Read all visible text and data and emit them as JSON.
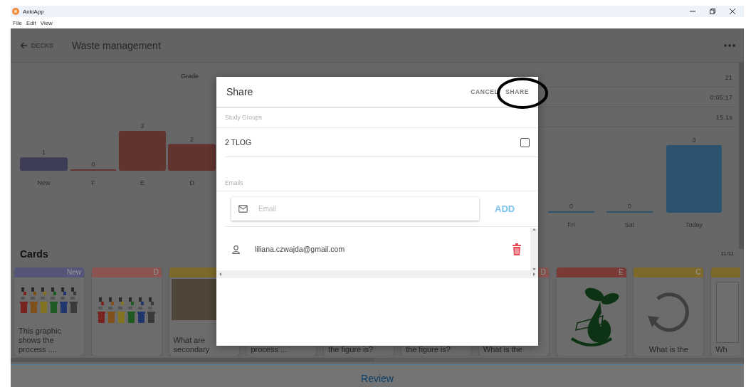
{
  "window": {
    "title": "AnkiApp"
  },
  "menu": [
    "File",
    "Edit",
    "View"
  ],
  "header": {
    "back_label": "DECKS",
    "title": "Waste management"
  },
  "grade": {
    "label": "Grade"
  },
  "grade_chart": {
    "chart_data": {
      "type": "bar",
      "categories": [
        "New",
        "F",
        "E",
        "D"
      ],
      "series": [
        {
          "color": "#3d3d55",
          "values": [
            1,
            null,
            null,
            null
          ]
        },
        {
          "color": "#62332f",
          "values": [
            null,
            0,
            3,
            2
          ]
        }
      ],
      "data_labels": true
    }
  },
  "stats": [
    {
      "value": "21"
    },
    {
      "value": "0:05:17"
    },
    {
      "value": "15.1s"
    }
  ],
  "review_chart": {
    "chart_data": {
      "type": "bar",
      "categories": [
        "Fri",
        "Sat",
        "Today"
      ],
      "series": [
        {
          "color": "#2b5370",
          "values": [
            0,
            0,
            3
          ]
        }
      ],
      "data_labels": true
    }
  },
  "cards": {
    "title": "Cards",
    "count": "11/11",
    "items": [
      {
        "kind": "bins",
        "grade": "New",
        "color": "#55557a",
        "text": "This graphic shows the process ...."
      },
      {
        "kind": "bins",
        "grade": "D",
        "color": "#8a5550"
      },
      {
        "kind": "photo",
        "color": "#7d6a2a",
        "text": "What are secondary"
      },
      {
        "kind": "covered",
        "text": "process ..."
      },
      {
        "kind": "covered",
        "text": "the figure is?"
      },
      {
        "kind": "covered",
        "text": "the figure is?"
      },
      {
        "kind": "covered",
        "grade": "D",
        "color": "#8a5550",
        "text": "What is the"
      },
      {
        "kind": "sprout",
        "grade": "E",
        "color": "#7a3a35"
      },
      {
        "kind": "cycle",
        "grade": "C",
        "color": "#7d6a2a",
        "text": "What is the"
      },
      {
        "kind": "partial",
        "color": "#7d6a2a",
        "text": "Wh"
      }
    ]
  },
  "share_dialog": {
    "title": "Share",
    "cancel": "CANCEL",
    "share": "SHARE",
    "study_groups_label": "Study Groups",
    "study_groups": [
      {
        "name": "2 TLOG",
        "checked": false
      }
    ],
    "emails_label": "Emails",
    "email_field": {
      "placeholder": "Email"
    },
    "add_button": "ADD",
    "emails": [
      {
        "address": "liliana.czwajda@gmail.com"
      }
    ]
  },
  "review_button": "Review"
}
